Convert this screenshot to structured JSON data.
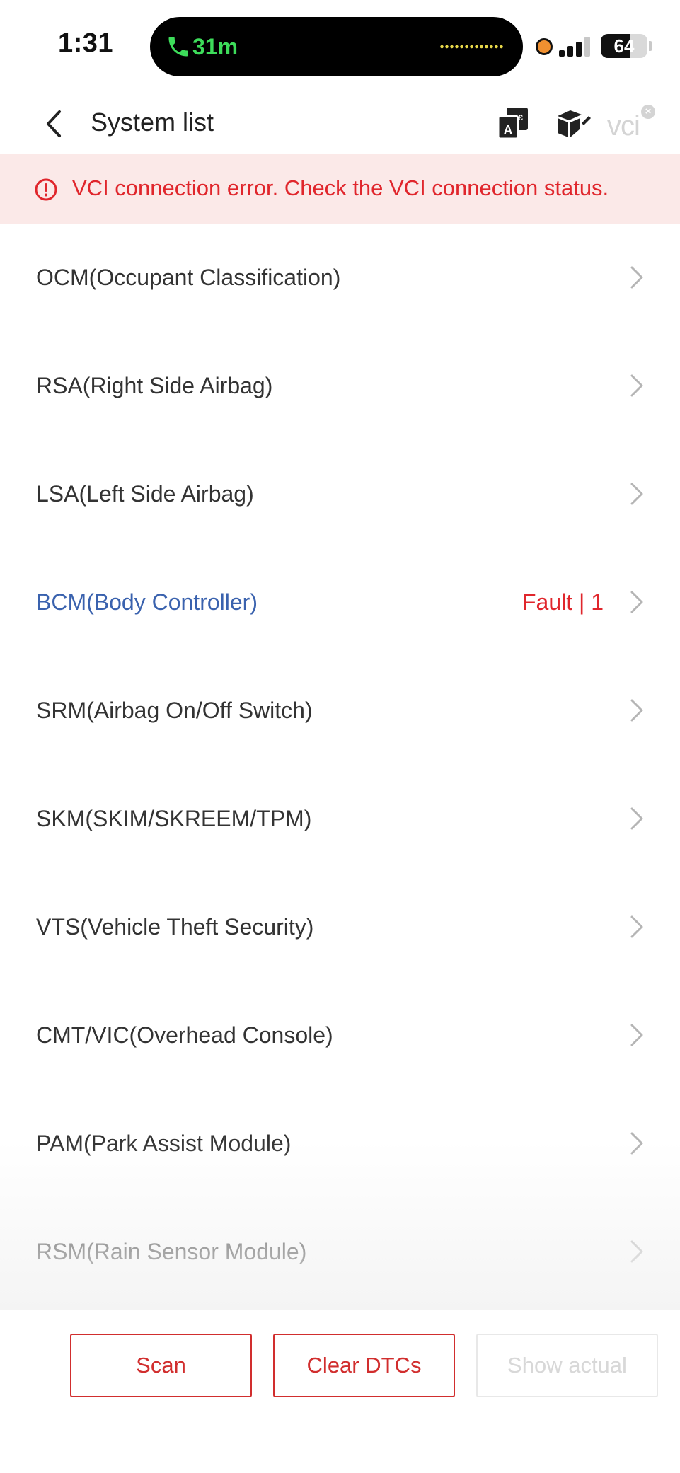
{
  "status_bar": {
    "time": "1:31",
    "call_timer": "31m",
    "battery": "64",
    "battery_level": 0.64,
    "icons": [
      "phone-icon",
      "waveform-icon",
      "recording-dot-icon",
      "signal-icon",
      "battery-icon"
    ]
  },
  "header": {
    "title": "System list",
    "icons": [
      "back-icon",
      "translate-icon",
      "box-icon",
      "vci-disconnected-icon"
    ],
    "vci_label": "VCI"
  },
  "error_banner": {
    "icon": "alert-circle-icon",
    "message": "VCI connection error. Check the VCI connection status."
  },
  "system_list": {
    "items": [
      {
        "label": "OCM(Occupant Classification)",
        "status": "",
        "fault": false
      },
      {
        "label": "RSA(Right Side Airbag)",
        "status": "",
        "fault": false
      },
      {
        "label": "LSA(Left Side Airbag)",
        "status": "",
        "fault": false
      },
      {
        "label": "BCM(Body Controller)",
        "status": "Fault | 1",
        "fault": true
      },
      {
        "label": "SRM(Airbag On/Off Switch)",
        "status": "",
        "fault": false
      },
      {
        "label": "SKM(SKIM/SKREEM/TPM)",
        "status": "",
        "fault": false
      },
      {
        "label": "VTS(Vehicle Theft Security)",
        "status": "",
        "fault": false
      },
      {
        "label": "CMT/VIC(Overhead Console)",
        "status": "",
        "fault": false
      },
      {
        "label": "PAM(Park Assist Module)",
        "status": "",
        "fault": false
      },
      {
        "label": "RSM(Rain Sensor Module)",
        "status": "",
        "fault": false
      }
    ]
  },
  "bottom_bar": {
    "scan_label": "Scan",
    "clear_label": "Clear DTCs",
    "actual_label": "Show actual"
  },
  "colors": {
    "accent_red": "#e0262c",
    "fault_blue": "#3a62ae",
    "banner_bg": "#fbe9e8",
    "call_green": "#3ddc5a"
  }
}
